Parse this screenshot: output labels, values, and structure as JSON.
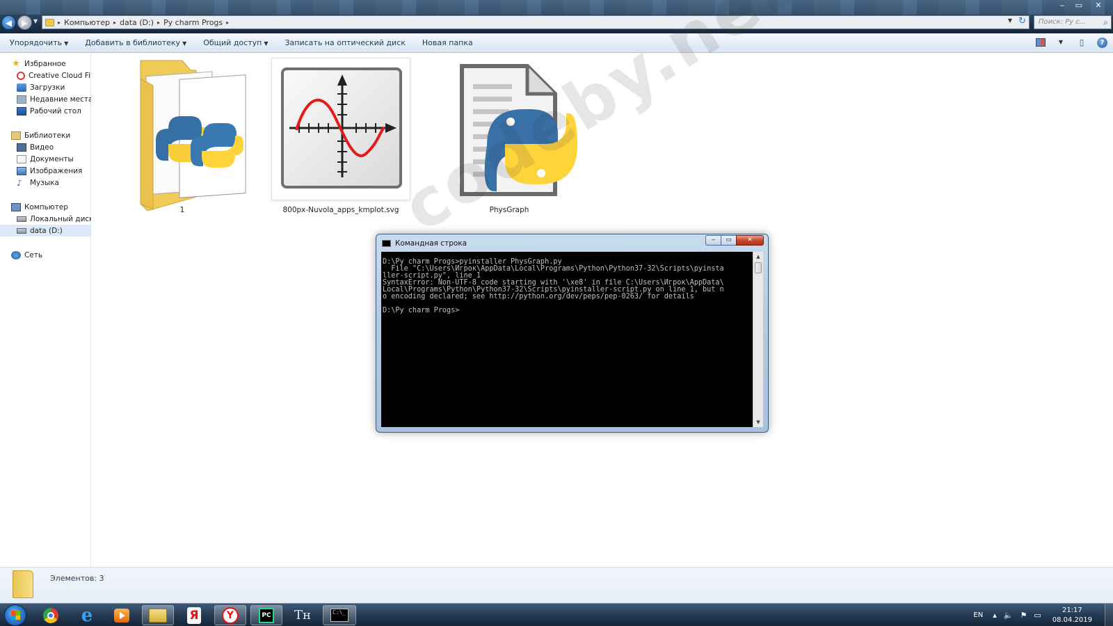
{
  "window": {
    "controls": {
      "minimize": "‒",
      "maximize": "▭",
      "close": "✕"
    }
  },
  "address": {
    "crumbs": [
      "Компьютер",
      "data (D:)",
      "Py charm Progs"
    ],
    "separator": "▸",
    "search_placeholder": "Поиск: Py c..."
  },
  "commandbar": {
    "organize": "Упорядочить",
    "add_library": "Добавить в библиотеку",
    "share": "Общий доступ",
    "burn": "Записать на оптический диск",
    "new_folder": "Новая папка"
  },
  "nav": {
    "favorites": "Избранное",
    "favorites_items": [
      "Creative Cloud Files",
      "Загрузки",
      "Недавние места",
      "Рабочий стол"
    ],
    "libraries": "Библиотеки",
    "library_items": [
      "Видео",
      "Документы",
      "Изображения",
      "Музыка"
    ],
    "computer": "Компьютер",
    "computer_items": [
      "Локальный диск (C",
      "data (D:)"
    ],
    "network": "Сеть"
  },
  "files": [
    {
      "name": "1",
      "icon": "folder-python-icon"
    },
    {
      "name": "800px-Nuvola_apps_kmplot.svg",
      "icon": "kmplot-graph-icon"
    },
    {
      "name": "PhysGraph",
      "icon": "python-script-icon"
    }
  ],
  "watermark": "codeby.net",
  "console": {
    "title": "Командная строка",
    "lines": [
      "D:\\Py charm Progs>pyinstaller PhysGraph.py",
      "  File \"C:\\Users\\Игрок\\AppData\\Local\\Programs\\Python\\Python37-32\\Scripts\\pyinsta",
      "ller-script.py\", line 1",
      "SyntaxError: Non-UTF-8 code starting with '\\xe8' in file C:\\Users\\Игрок\\AppData\\",
      "Local\\Programs\\Python\\Python37-32\\Scripts\\pyinstaller-script.py on line 1, but n",
      "o encoding declared; see http://python.org/dev/peps/pep-0263/ for details",
      "",
      "D:\\Py charm Progs>"
    ]
  },
  "details": {
    "count": "Элементов: 3"
  },
  "taskbar": {
    "lang": "EN",
    "time": "21:17",
    "date": "08.04.2019",
    "pycharm_label": "PC",
    "yandex_label": "Я",
    "yandex_browser_label": "Y",
    "ie_label": "e",
    "th_label": "Tн"
  },
  "colors": {
    "aero_top": "#3c5d7e",
    "commandbar": "#e5edf7",
    "console_bg": "#000000",
    "console_text": "#c0c0c0",
    "taskbar": "#263d57"
  }
}
